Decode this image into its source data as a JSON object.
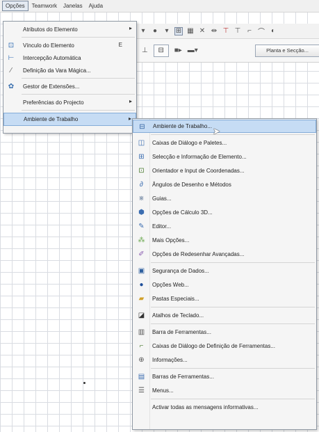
{
  "menubar": {
    "items": [
      "Opções",
      "Teamwork",
      "Janelas",
      "Ajuda"
    ]
  },
  "toolbar": {
    "planta_label": "Planta e Secção..."
  },
  "options_menu": {
    "items": [
      {
        "label": "Atributos do Elemento"
      },
      {
        "label": "Vínculo do Elemento",
        "shortcut": "E"
      },
      {
        "label": "Intercepção Automática"
      },
      {
        "label": "Definição da Vara Mágica..."
      },
      {
        "label": "Gestor de Extensões..."
      },
      {
        "label": "Preferências do Projecto"
      },
      {
        "label": "Ambiente de Trabalho"
      }
    ]
  },
  "work_env_submenu": {
    "items": [
      {
        "label": "Ambiente de Trabalho..."
      },
      {
        "label": "Caixas de Diálogo e Paletes..."
      },
      {
        "label": "Selecção e Informação de Elemento..."
      },
      {
        "label": "Orientador e Input de Coordenadas..."
      },
      {
        "label": "Ângulos de Desenho e Métodos"
      },
      {
        "label": "Guias..."
      },
      {
        "label": "Opções de Cálculo 3D..."
      },
      {
        "label": "Editor..."
      },
      {
        "label": "Mais Opções..."
      },
      {
        "label": "Opções de Redesenhar Avançadas..."
      },
      {
        "label": "Segurança de Dados..."
      },
      {
        "label": "Opções Web..."
      },
      {
        "label": "Pastas Especiais..."
      },
      {
        "label": "Atalhos de Teclado..."
      },
      {
        "label": "Barra de Ferramentas..."
      },
      {
        "label": "Caixas de Diálogo de Definição de Ferramentas..."
      },
      {
        "label": "Informações..."
      },
      {
        "label": "Barras de Ferramentas..."
      },
      {
        "label": "Menus..."
      },
      {
        "label": "Activar todas as mensagens informativas..."
      }
    ]
  },
  "colors": {
    "highlight": "#c6dcf4",
    "highlight_border": "#84acd8",
    "menu_bg": "#f5f5f5"
  }
}
